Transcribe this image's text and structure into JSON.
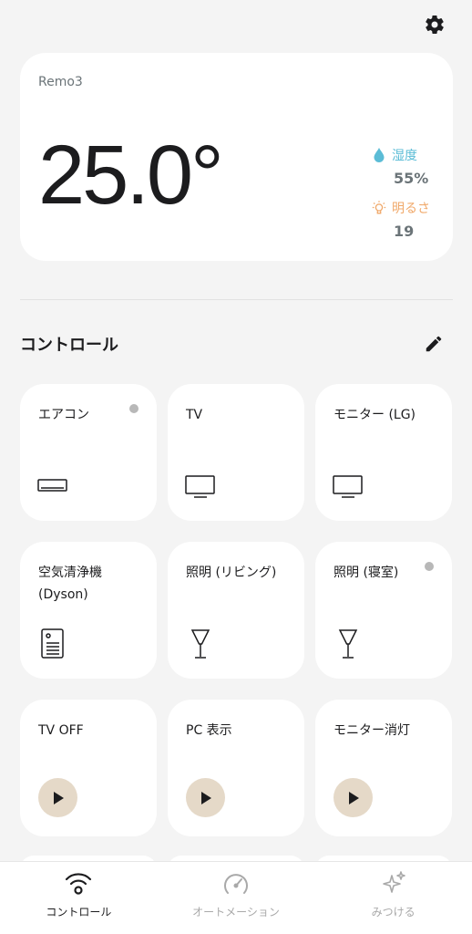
{
  "header": {
    "settings_icon": "gear-icon"
  },
  "device": {
    "name": "Remo3",
    "temperature": "25.0°",
    "humidity": {
      "label": "湿度",
      "value": "55%",
      "icon": "water-drop-icon",
      "color": "#5bbcd6"
    },
    "brightness": {
      "label": "明るさ",
      "value": "19",
      "icon": "light-bulb-icon",
      "color": "#f0a869"
    }
  },
  "controls": {
    "title": "コントロール",
    "edit_icon": "pencil-icon",
    "tiles": [
      {
        "label": "エアコン",
        "icon": "air-conditioner-icon",
        "status_dot": true
      },
      {
        "label": "TV",
        "icon": "tv-icon",
        "status_dot": false
      },
      {
        "label": "モニター (LG)",
        "icon": "tv-icon",
        "status_dot": false
      },
      {
        "label": "空気清浄機 (Dyson)",
        "icon": "air-purifier-icon",
        "status_dot": false
      },
      {
        "label": "照明 (リビング)",
        "icon": "lamp-icon",
        "status_dot": false
      },
      {
        "label": "照明 (寝室)",
        "icon": "lamp-icon",
        "status_dot": true
      },
      {
        "label": "TV OFF",
        "icon": "play-icon",
        "status_dot": false
      },
      {
        "label": "PC 表示",
        "icon": "play-icon",
        "status_dot": false
      },
      {
        "label": "モニター消灯",
        "icon": "play-icon",
        "status_dot": false
      }
    ]
  },
  "tabbar": {
    "tabs": [
      {
        "label": "コントロール",
        "icon": "wifi-remote-icon",
        "active": true
      },
      {
        "label": "オートメーション",
        "icon": "automation-gauge-icon",
        "active": false
      },
      {
        "label": "みつける",
        "icon": "sparkles-icon",
        "active": false
      }
    ]
  },
  "colors": {
    "accent_play": "#e5d9c8",
    "status_dot": "#b8b8b8",
    "background": "#f4f4f4"
  }
}
